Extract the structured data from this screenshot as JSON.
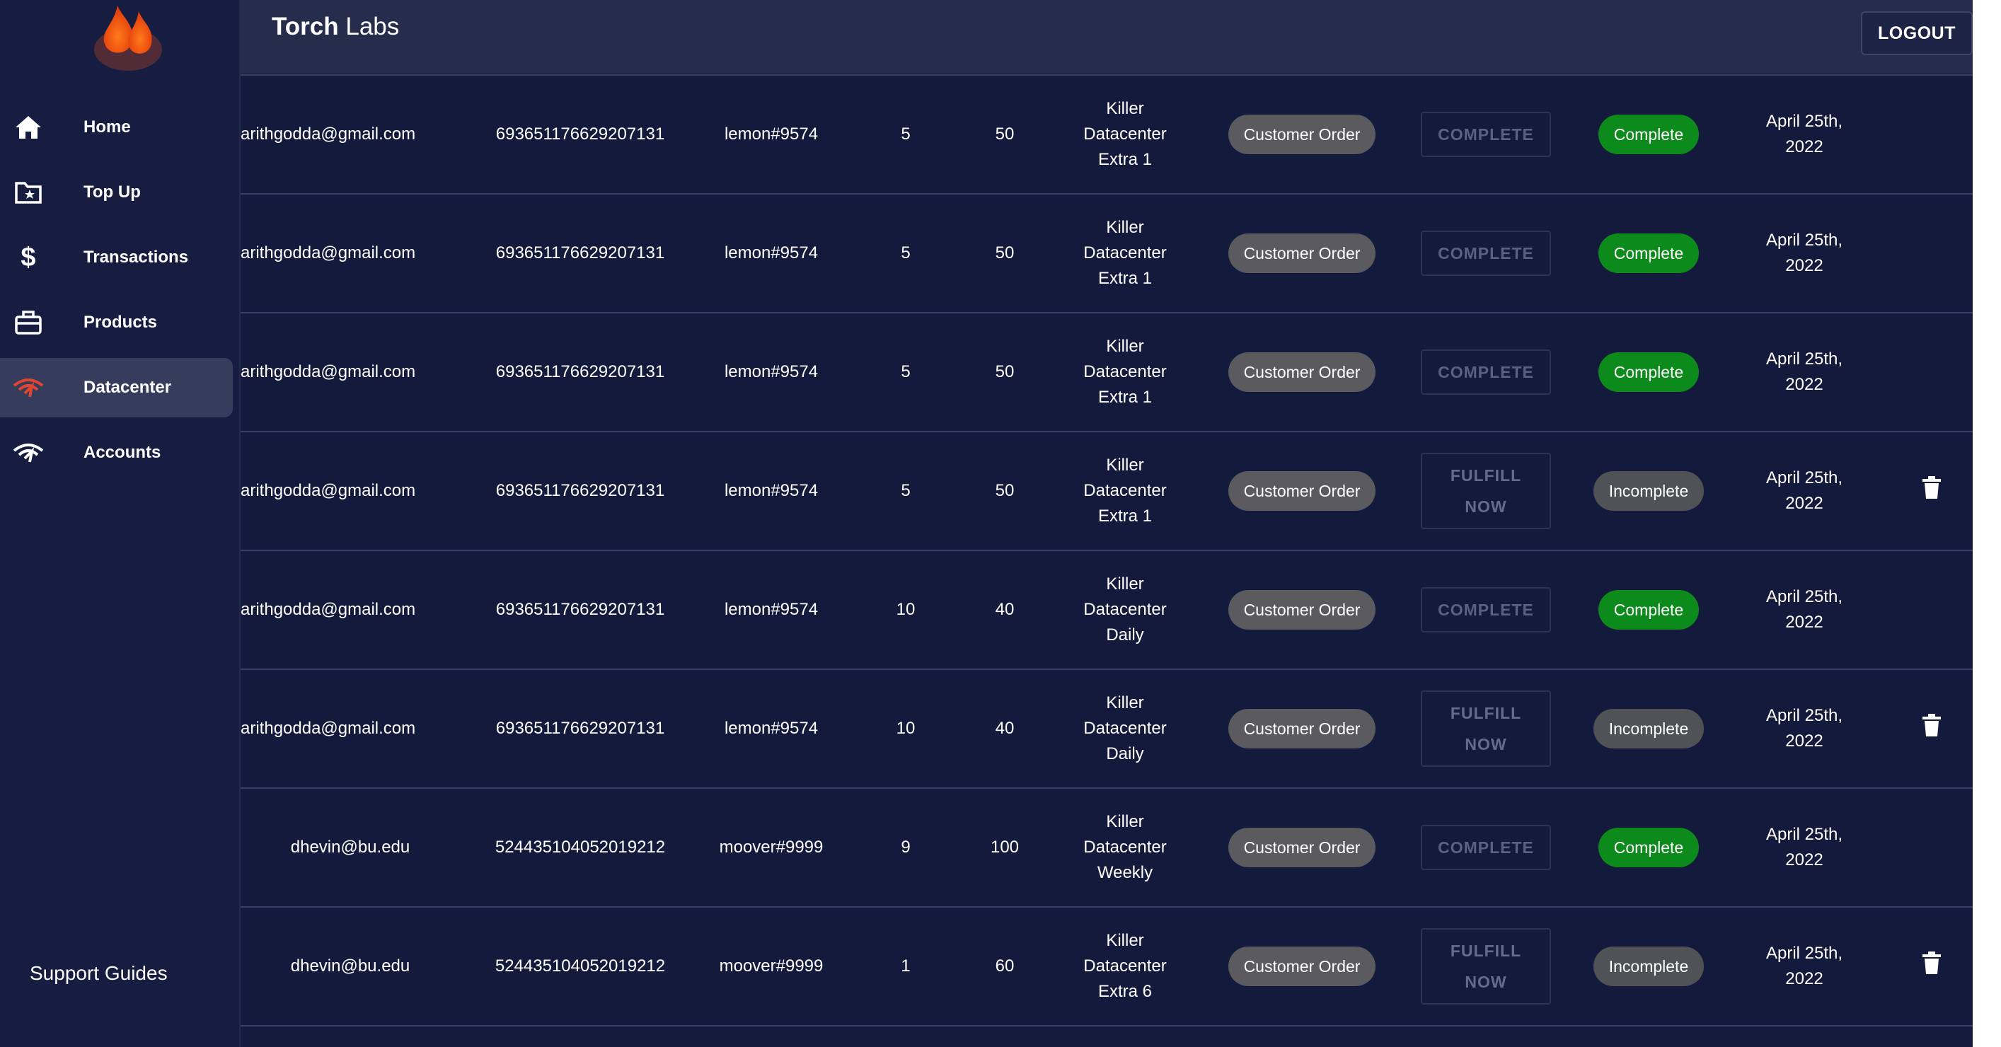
{
  "brand": {
    "bold": "Torch",
    "rest": " Labs"
  },
  "header": {
    "logout_label": "LOGOUT"
  },
  "sidebar": {
    "items": [
      {
        "label": "Home",
        "icon": "home-icon"
      },
      {
        "label": "Top Up",
        "icon": "folder-star-icon"
      },
      {
        "label": "Transactions",
        "icon": "dollar-icon"
      },
      {
        "label": "Products",
        "icon": "briefcase-icon"
      },
      {
        "label": "Datacenter",
        "icon": "wifi-icon",
        "active": true
      },
      {
        "label": "Accounts",
        "icon": "wifi-icon"
      }
    ],
    "support_label": "Support Guides"
  },
  "colors": {
    "accent_green": "#0c8a1c",
    "active_icon": "#e0462f",
    "bg": "#151b3d"
  },
  "rows": [
    {
      "email": "arithgodda@gmail.com",
      "id": "693651176629207131",
      "user": "lemon#9574",
      "q1": "5",
      "q2": "50",
      "product": [
        "Killer",
        "Datacenter",
        "Extra 1"
      ],
      "type": "Customer Order",
      "action": "COMPLETE",
      "status": "Complete",
      "date": [
        "April 25th,",
        "2022"
      ]
    },
    {
      "email": "arithgodda@gmail.com",
      "id": "693651176629207131",
      "user": "lemon#9574",
      "q1": "5",
      "q2": "50",
      "product": [
        "Killer",
        "Datacenter",
        "Extra 1"
      ],
      "type": "Customer Order",
      "action": "COMPLETE",
      "status": "Complete",
      "date": [
        "April 25th,",
        "2022"
      ]
    },
    {
      "email": "arithgodda@gmail.com",
      "id": "693651176629207131",
      "user": "lemon#9574",
      "q1": "5",
      "q2": "50",
      "product": [
        "Killer",
        "Datacenter",
        "Extra 1"
      ],
      "type": "Customer Order",
      "action": "COMPLETE",
      "status": "Complete",
      "date": [
        "April 25th,",
        "2022"
      ]
    },
    {
      "email": "arithgodda@gmail.com",
      "id": "693651176629207131",
      "user": "lemon#9574",
      "q1": "5",
      "q2": "50",
      "product": [
        "Killer",
        "Datacenter",
        "Extra 1"
      ],
      "type": "Customer Order",
      "action": [
        "FULFILL",
        "NOW"
      ],
      "status": "Incomplete",
      "date": [
        "April 25th,",
        "2022"
      ]
    },
    {
      "email": "arithgodda@gmail.com",
      "id": "693651176629207131",
      "user": "lemon#9574",
      "q1": "10",
      "q2": "40",
      "product": [
        "Killer",
        "Datacenter",
        "Daily"
      ],
      "type": "Customer Order",
      "action": "COMPLETE",
      "status": "Complete",
      "date": [
        "April 25th,",
        "2022"
      ]
    },
    {
      "email": "arithgodda@gmail.com",
      "id": "693651176629207131",
      "user": "lemon#9574",
      "q1": "10",
      "q2": "40",
      "product": [
        "Killer",
        "Datacenter",
        "Daily"
      ],
      "type": "Customer Order",
      "action": [
        "FULFILL",
        "NOW"
      ],
      "status": "Incomplete",
      "date": [
        "April 25th,",
        "2022"
      ]
    },
    {
      "email": "dhevin@bu.edu",
      "id": "524435104052019212",
      "user": "moover#9999",
      "q1": "9",
      "q2": "100",
      "product": [
        "Killer",
        "Datacenter",
        "Weekly"
      ],
      "type": "Customer Order",
      "action": "COMPLETE",
      "status": "Complete",
      "date": [
        "April 25th,",
        "2022"
      ]
    },
    {
      "email": "dhevin@bu.edu",
      "id": "524435104052019212",
      "user": "moover#9999",
      "q1": "1",
      "q2": "60",
      "product": [
        "Killer",
        "Datacenter",
        "Extra 6"
      ],
      "type": "Customer Order",
      "action": [
        "FULFILL",
        "NOW"
      ],
      "status": "Incomplete",
      "date": [
        "April 25th,",
        "2022"
      ]
    }
  ]
}
